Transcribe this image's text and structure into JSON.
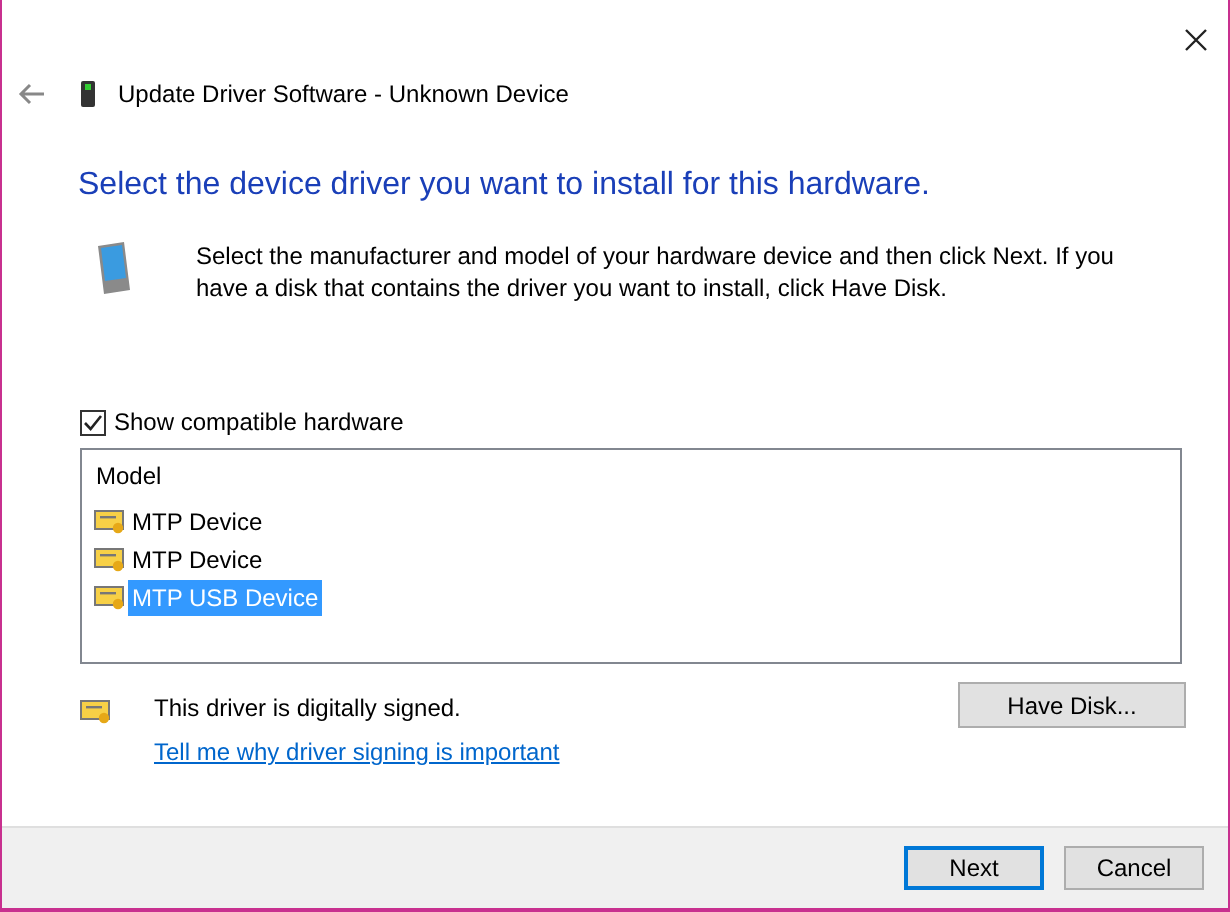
{
  "window": {
    "title": "Update Driver Software - Unknown Device"
  },
  "heading": "Select the device driver you want to install for this hardware.",
  "description": "Select the manufacturer and model of your hardware device and then click Next. If you have a disk that contains the driver you want to install, click Have Disk.",
  "compatible": {
    "label": "Show compatible hardware",
    "checked": true
  },
  "model_list": {
    "header": "Model",
    "items": [
      {
        "label": "MTP Device",
        "selected": false
      },
      {
        "label": "MTP Device",
        "selected": false
      },
      {
        "label": "MTP USB Device",
        "selected": true
      }
    ]
  },
  "signing": {
    "text": "This driver is digitally signed.",
    "link": "Tell me why driver signing is important"
  },
  "have_disk_button": "Have Disk...",
  "buttons": [
    {
      "label": "Next",
      "default": true
    },
    {
      "label": "Cancel",
      "default": false
    }
  ]
}
